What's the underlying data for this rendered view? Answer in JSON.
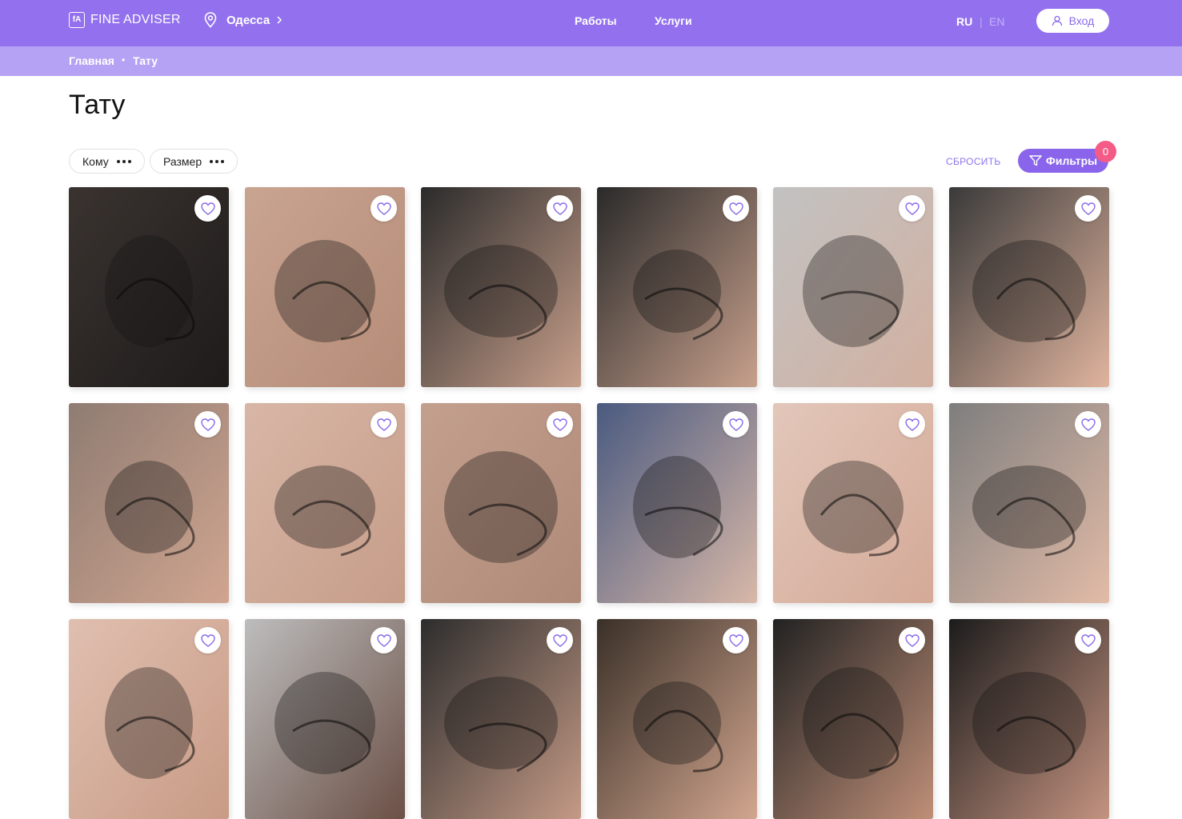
{
  "header": {
    "logo_mark": "fA",
    "logo_text": "FINE ADVISER",
    "city": "Одесса",
    "nav": [
      "Работы",
      "Услуги"
    ],
    "lang_ru": "RU",
    "lang_sep": "|",
    "lang_en": "EN",
    "login": "Вход"
  },
  "breadcrumb": {
    "items": [
      "Главная",
      "Тату"
    ],
    "separator": "•"
  },
  "page": {
    "title": "Тату"
  },
  "filters": {
    "chips": [
      "Кому",
      "Размер"
    ],
    "reset": "СБРОСИТЬ",
    "button": "Фильтры",
    "count": "0"
  },
  "colors": {
    "header_bg": "#9371ee",
    "breadcrumb_bg": "#b6a2f4",
    "accent": "#8a65ec",
    "badge": "#f45b86"
  },
  "gallery": {
    "icon": "heart-icon",
    "rows_visible": 3,
    "columns": 6
  }
}
